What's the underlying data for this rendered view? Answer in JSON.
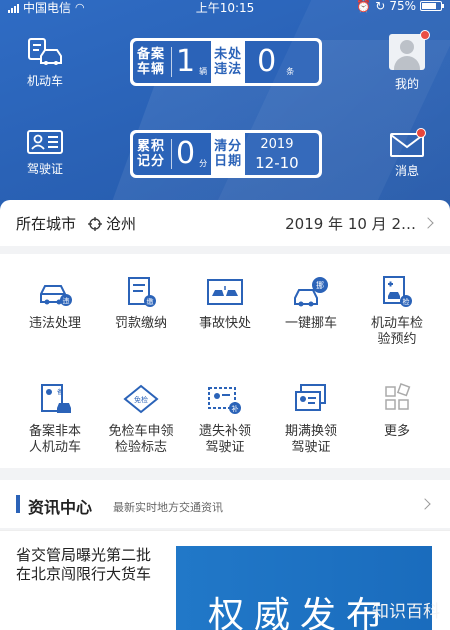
{
  "status": {
    "carrier": "中国电信",
    "time": "上午10:15",
    "battery": "75%"
  },
  "header": {
    "vehicle_label": "机动车",
    "license_label": "驾驶证",
    "me_label": "我的",
    "msg_label": "消息",
    "vehicle_panel": {
      "reg_label1": "备案",
      "reg_label2": "车辆",
      "reg_count": "1",
      "reg_unit": "辆",
      "unproc_label1": "未处",
      "unproc_label2": "违法",
      "unproc_count": "0",
      "unproc_unit": "条"
    },
    "license_panel": {
      "acc_label1": "累积",
      "acc_label2": "记分",
      "acc_score": "0",
      "acc_unit": "分",
      "clear_label1": "清分",
      "clear_label2": "日期",
      "clear_year": "2019",
      "clear_date": "12-10"
    }
  },
  "city": {
    "label": "所在城市",
    "name": "沧州",
    "date": "2019 年 10 月 2…"
  },
  "services": [
    {
      "label1": "违法处理",
      "label2": "",
      "icon": "car-violation-icon"
    },
    {
      "label1": "罚款缴纳",
      "label2": "",
      "icon": "fine-payment-icon"
    },
    {
      "label1": "事故快处",
      "label2": "",
      "icon": "accident-icon"
    },
    {
      "label1": "一键挪车",
      "label2": "",
      "icon": "move-car-icon"
    },
    {
      "label1": "机动车检",
      "label2": "验预约",
      "icon": "inspection-icon"
    },
    {
      "label1": "备案非本",
      "label2": "人机动车",
      "icon": "register-vehicle-icon"
    },
    {
      "label1": "免检车申领",
      "label2": "检验标志",
      "icon": "exempt-badge-icon"
    },
    {
      "label1": "遗失补领",
      "label2": "驾驶证",
      "icon": "license-replace-icon"
    },
    {
      "label1": "期满换领",
      "label2": "驾驶证",
      "icon": "license-renew-icon"
    },
    {
      "label1": "更多",
      "label2": "",
      "icon": "more-icon"
    }
  ],
  "news": {
    "title": "资讯中心",
    "subtitle": "最新实时地方交通资讯",
    "headline": "省交管局曝光第二批在北京闯限行大货车",
    "thumb_text": "权威发布",
    "watermark": "知识百科"
  },
  "colors": {
    "primary": "#2b63b8",
    "accent_red": "#e8463c"
  }
}
